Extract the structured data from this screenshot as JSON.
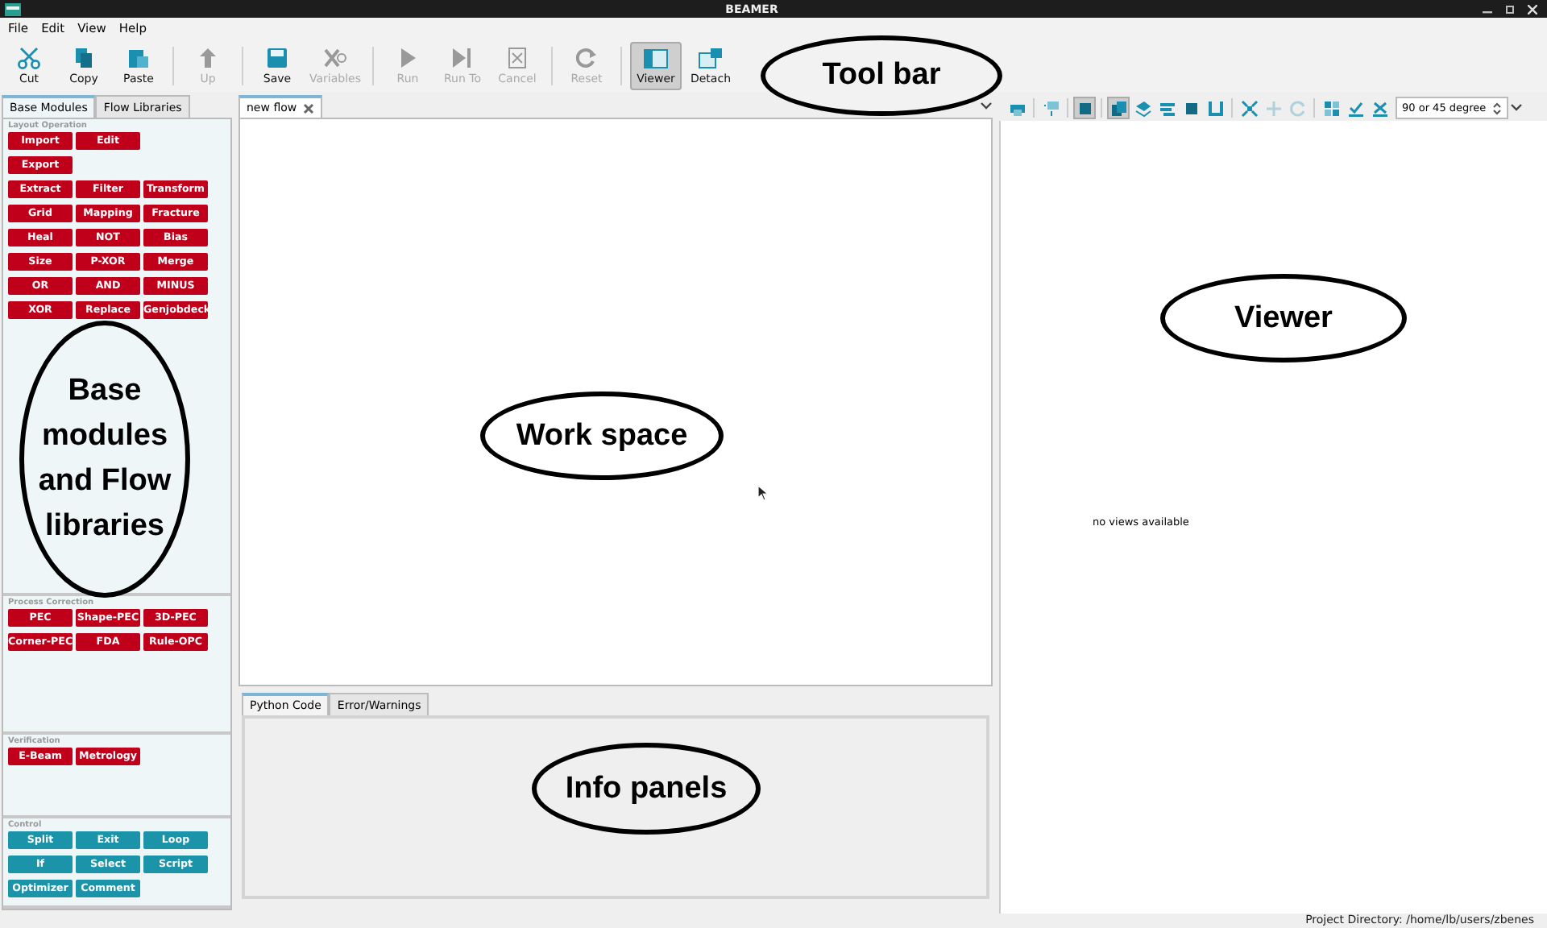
{
  "window": {
    "title": "BEAMER"
  },
  "menu": [
    "File",
    "Edit",
    "View",
    "Help"
  ],
  "toolbar": [
    [
      {
        "label": "Cut",
        "kind": "cut",
        "disabled": false,
        "pressed": false
      },
      {
        "label": "Copy",
        "kind": "copy",
        "disabled": false,
        "pressed": false
      },
      {
        "label": "Paste",
        "kind": "paste",
        "disabled": false,
        "pressed": false
      }
    ],
    [
      {
        "label": "Up",
        "kind": "up",
        "disabled": true,
        "pressed": false
      }
    ],
    [
      {
        "label": "Save",
        "kind": "save",
        "disabled": false,
        "pressed": false
      },
      {
        "label": "Variables",
        "kind": "variables",
        "disabled": true,
        "pressed": false
      }
    ],
    [
      {
        "label": "Run",
        "kind": "run",
        "disabled": true,
        "pressed": false
      },
      {
        "label": "Run To",
        "kind": "runto",
        "disabled": true,
        "pressed": false
      },
      {
        "label": "Cancel",
        "kind": "cancel",
        "disabled": true,
        "pressed": false
      }
    ],
    [
      {
        "label": "Reset",
        "kind": "reset",
        "disabled": true,
        "pressed": false
      }
    ],
    [
      {
        "label": "Viewer",
        "kind": "viewer",
        "disabled": false,
        "pressed": true
      },
      {
        "label": "Detach",
        "kind": "detach",
        "disabled": false,
        "pressed": false
      }
    ]
  ],
  "left_tabs": [
    {
      "label": "Base Modules",
      "selected": true
    },
    {
      "label": "Flow Libraries",
      "selected": false
    }
  ],
  "sections": [
    {
      "title": "Layout Operation",
      "color": "#c0001a",
      "buttons": [
        [
          "Import",
          "Edit"
        ],
        [
          "Export"
        ],
        [
          "Extract",
          "Filter",
          "Transform"
        ],
        [
          "Grid",
          "Mapping",
          "Fracture"
        ],
        [
          "Heal",
          "NOT",
          "Bias"
        ],
        [
          "Size",
          "P-XOR",
          "Merge"
        ],
        [
          "OR",
          "AND",
          "MINUS"
        ],
        [
          "XOR",
          "Replace",
          "Genjobdeck"
        ]
      ]
    },
    {
      "title": "Process Correction",
      "color": "#c0001a",
      "buttons": [
        [
          "PEC",
          "Shape-PEC",
          "3D-PEC"
        ],
        [
          "Corner-PEC",
          "FDA",
          "Rule-OPC"
        ]
      ]
    },
    {
      "title": "Verification",
      "color": "#c0001a",
      "buttons": [
        [
          "E-Beam",
          "Metrology"
        ]
      ]
    },
    {
      "title": "Control",
      "color": "#1b93a8",
      "buttons": [
        [
          "Split",
          "Exit",
          "Loop"
        ],
        [
          "If",
          "Select",
          "Script"
        ],
        [
          "Optimizer",
          "Comment"
        ]
      ]
    }
  ],
  "flow_tabs": [
    {
      "label": "new flow",
      "selected": true
    }
  ],
  "info_tabs": [
    {
      "label": "Python Code",
      "selected": true
    },
    {
      "label": "Error/Warnings",
      "selected": false
    }
  ],
  "viewer": {
    "tools": [
      [
        {
          "kind": "print",
          "disabled": false,
          "pressed": false
        }
      ],
      [
        {
          "kind": "tree",
          "disabled": false,
          "pressed": false
        }
      ],
      [
        {
          "kind": "square",
          "disabled": false,
          "pressed": true
        }
      ],
      [
        {
          "kind": "stack",
          "disabled": false,
          "pressed": true
        },
        {
          "kind": "layers",
          "disabled": false,
          "pressed": false
        },
        {
          "kind": "lines",
          "disabled": false,
          "pressed": false
        },
        {
          "kind": "square",
          "disabled": false,
          "pressed": false
        },
        {
          "kind": "cup",
          "disabled": false,
          "pressed": false
        }
      ],
      [
        {
          "kind": "fit",
          "disabled": false,
          "pressed": false
        },
        {
          "kind": "move",
          "disabled": true,
          "pressed": false
        },
        {
          "kind": "rotate",
          "disabled": true,
          "pressed": false
        }
      ],
      [
        {
          "kind": "grid",
          "disabled": false,
          "pressed": false
        },
        {
          "kind": "check",
          "disabled": false,
          "pressed": false
        },
        {
          "kind": "cross",
          "disabled": false,
          "pressed": false
        }
      ]
    ],
    "angle": "90 or 45 degree",
    "message": "no views available"
  },
  "status_bar": "Project Directory: /home/lb/users/zbenes",
  "callouts": [
    {
      "text": "Tool bar"
    },
    {
      "text": "Viewer"
    },
    {
      "text": "Work space"
    },
    {
      "text": "Info panels"
    },
    {
      "text": "Base modules and Flow libraries"
    }
  ]
}
